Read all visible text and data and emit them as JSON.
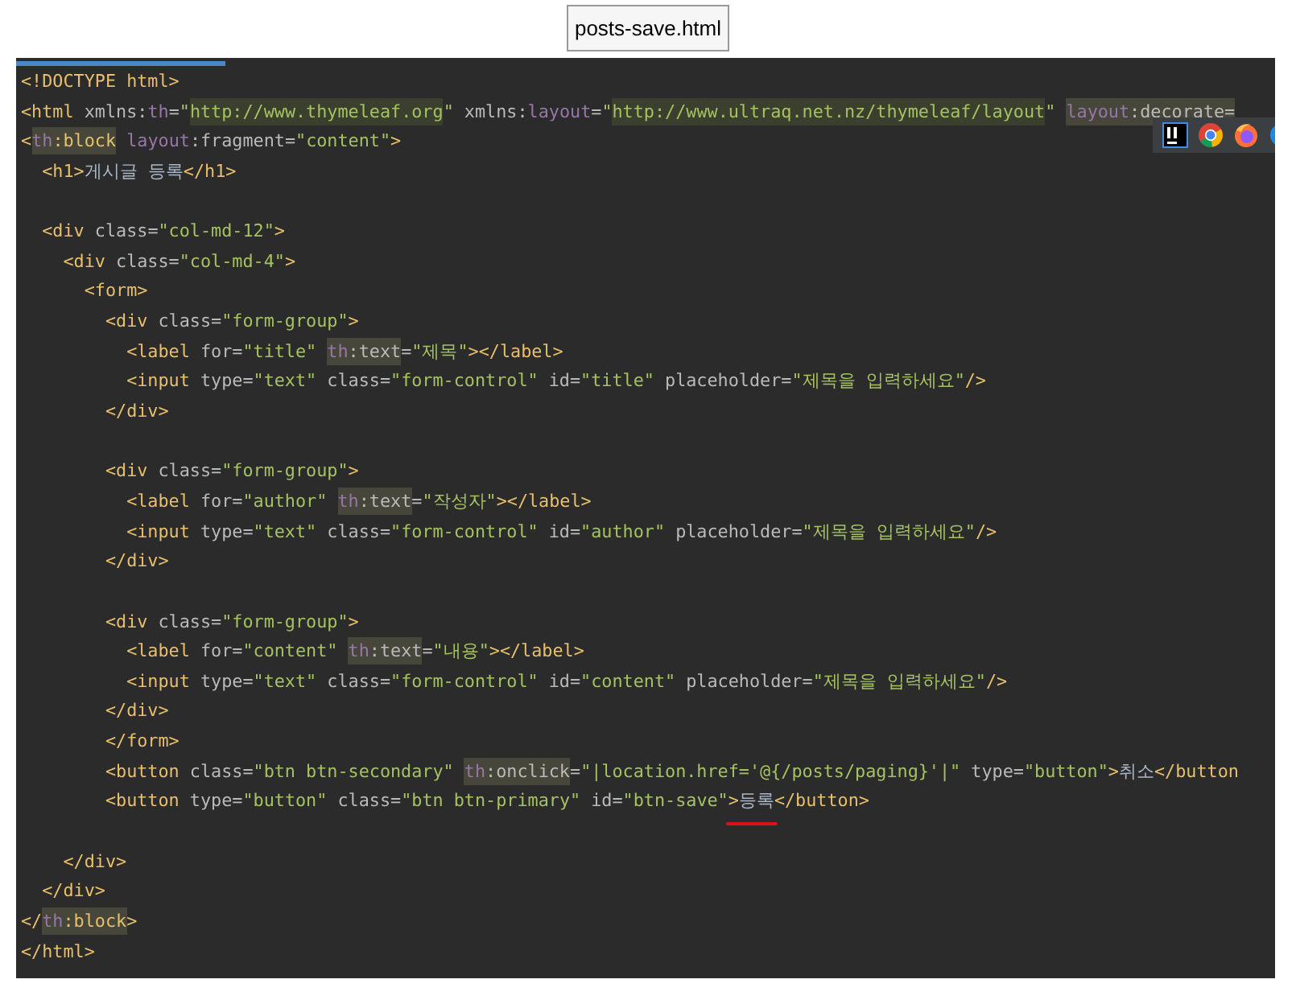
{
  "file_title": "posts-save.html",
  "lines": [
    {
      "kind": "code",
      "tokens": [
        {
          "kind": "tag",
          "text": "<!DOCTYPE html>"
        }
      ]
    },
    {
      "kind": "code",
      "tokens": [
        {
          "kind": "tag",
          "text": "<html "
        },
        {
          "kind": "attr",
          "text": "xmlns:"
        },
        {
          "kind": "ns",
          "text": "th"
        },
        {
          "kind": "attr",
          "text": "="
        },
        {
          "kind": "str",
          "text": "\""
        },
        {
          "kind": "strhl",
          "text": "http://www.thymeleaf.org"
        },
        {
          "kind": "str",
          "text": "\""
        },
        {
          "kind": "attr",
          "text": " xmlns:"
        },
        {
          "kind": "ns",
          "text": "layout"
        },
        {
          "kind": "attr",
          "text": "="
        },
        {
          "kind": "str",
          "text": "\""
        },
        {
          "kind": "strhl",
          "text": "http://www.ultraq.net.nz/thymeleaf/layout"
        },
        {
          "kind": "str",
          "text": "\" "
        },
        {
          "kind": "nshl",
          "text": "layout"
        },
        {
          "kind": "attrhl",
          "text": ":decorate="
        }
      ]
    },
    {
      "kind": "code",
      "tokens": [
        {
          "kind": "tag",
          "text": "<"
        },
        {
          "kind": "nshl",
          "text": "th"
        },
        {
          "kind": "taghl",
          "text": ":block"
        },
        {
          "kind": "ns",
          "text": " layout"
        },
        {
          "kind": "attr",
          "text": ":fragment="
        },
        {
          "kind": "str",
          "text": "\"content\""
        },
        {
          "kind": "tag",
          "text": ">"
        }
      ]
    },
    {
      "kind": "code",
      "tokens": [
        {
          "kind": "tag",
          "text": "  <h1>"
        },
        {
          "kind": "text",
          "text": "게시글 등록"
        },
        {
          "kind": "tag",
          "text": "</h1>"
        }
      ]
    },
    {
      "kind": "blank"
    },
    {
      "kind": "code",
      "tokens": [
        {
          "kind": "tag",
          "text": "  <div "
        },
        {
          "kind": "attr",
          "text": "class="
        },
        {
          "kind": "str",
          "text": "\"col-md-12\""
        },
        {
          "kind": "tag",
          "text": ">"
        }
      ]
    },
    {
      "kind": "code",
      "tokens": [
        {
          "kind": "tag",
          "text": "    <div "
        },
        {
          "kind": "attr",
          "text": "class="
        },
        {
          "kind": "str",
          "text": "\"col-md-4\""
        },
        {
          "kind": "tag",
          "text": ">"
        }
      ]
    },
    {
      "kind": "code",
      "tokens": [
        {
          "kind": "tag",
          "text": "      <form>"
        }
      ]
    },
    {
      "kind": "code",
      "tokens": [
        {
          "kind": "tag",
          "text": "        <div "
        },
        {
          "kind": "attr",
          "text": "class="
        },
        {
          "kind": "str",
          "text": "\"form-group\""
        },
        {
          "kind": "tag",
          "text": ">"
        }
      ]
    },
    {
      "kind": "code",
      "tokens": [
        {
          "kind": "tag",
          "text": "          <label "
        },
        {
          "kind": "attr",
          "text": "for="
        },
        {
          "kind": "str",
          "text": "\"title\" "
        },
        {
          "kind": "nshl",
          "text": "th"
        },
        {
          "kind": "attrhl",
          "text": ":text"
        },
        {
          "kind": "attr",
          "text": "="
        },
        {
          "kind": "str",
          "text": "\"제목\""
        },
        {
          "kind": "tag",
          "text": "></label>"
        }
      ]
    },
    {
      "kind": "code",
      "tokens": [
        {
          "kind": "tag",
          "text": "          <input "
        },
        {
          "kind": "attr",
          "text": "type="
        },
        {
          "kind": "str",
          "text": "\"text\""
        },
        {
          "kind": "attr",
          "text": " class="
        },
        {
          "kind": "str",
          "text": "\"form-control\""
        },
        {
          "kind": "attr",
          "text": " id="
        },
        {
          "kind": "str",
          "text": "\"title\""
        },
        {
          "kind": "attr",
          "text": " placeholder="
        },
        {
          "kind": "str",
          "text": "\"제목을 입력하세요\""
        },
        {
          "kind": "tag",
          "text": "/>"
        }
      ]
    },
    {
      "kind": "code",
      "tokens": [
        {
          "kind": "tag",
          "text": "        </div>"
        }
      ]
    },
    {
      "kind": "blank"
    },
    {
      "kind": "code",
      "tokens": [
        {
          "kind": "tag",
          "text": "        <div "
        },
        {
          "kind": "attr",
          "text": "class="
        },
        {
          "kind": "str",
          "text": "\"form-group\""
        },
        {
          "kind": "tag",
          "text": ">"
        }
      ]
    },
    {
      "kind": "code",
      "tokens": [
        {
          "kind": "tag",
          "text": "          <label "
        },
        {
          "kind": "attr",
          "text": "for="
        },
        {
          "kind": "str",
          "text": "\"author\" "
        },
        {
          "kind": "nshl",
          "text": "th"
        },
        {
          "kind": "attrhl",
          "text": ":text"
        },
        {
          "kind": "attr",
          "text": "="
        },
        {
          "kind": "str",
          "text": "\"작성자\""
        },
        {
          "kind": "tag",
          "text": "></label>"
        }
      ]
    },
    {
      "kind": "code",
      "tokens": [
        {
          "kind": "tag",
          "text": "          <input "
        },
        {
          "kind": "attr",
          "text": "type="
        },
        {
          "kind": "str",
          "text": "\"text\""
        },
        {
          "kind": "attr",
          "text": " class="
        },
        {
          "kind": "str",
          "text": "\"form-control\""
        },
        {
          "kind": "attr",
          "text": " id="
        },
        {
          "kind": "str",
          "text": "\"author\""
        },
        {
          "kind": "attr",
          "text": " placeholder="
        },
        {
          "kind": "str",
          "text": "\"제목을 입력하세요\""
        },
        {
          "kind": "tag",
          "text": "/>"
        }
      ]
    },
    {
      "kind": "code",
      "tokens": [
        {
          "kind": "tag",
          "text": "        </div>"
        }
      ]
    },
    {
      "kind": "blank"
    },
    {
      "kind": "code",
      "tokens": [
        {
          "kind": "tag",
          "text": "        <div "
        },
        {
          "kind": "attr",
          "text": "class="
        },
        {
          "kind": "str",
          "text": "\"form-group\""
        },
        {
          "kind": "tag",
          "text": ">"
        }
      ]
    },
    {
      "kind": "code",
      "tokens": [
        {
          "kind": "tag",
          "text": "          <label "
        },
        {
          "kind": "attr",
          "text": "for="
        },
        {
          "kind": "str",
          "text": "\"content\" "
        },
        {
          "kind": "nshl",
          "text": "th"
        },
        {
          "kind": "attrhl",
          "text": ":text"
        },
        {
          "kind": "attr",
          "text": "="
        },
        {
          "kind": "str",
          "text": "\"내용\""
        },
        {
          "kind": "tag",
          "text": "></label>"
        }
      ]
    },
    {
      "kind": "code",
      "tokens": [
        {
          "kind": "tag",
          "text": "          <input "
        },
        {
          "kind": "attr",
          "text": "type="
        },
        {
          "kind": "str",
          "text": "\"text\""
        },
        {
          "kind": "attr",
          "text": " class="
        },
        {
          "kind": "str",
          "text": "\"form-control\""
        },
        {
          "kind": "attr",
          "text": " id="
        },
        {
          "kind": "str",
          "text": "\"content\""
        },
        {
          "kind": "attr",
          "text": " placeholder="
        },
        {
          "kind": "str",
          "text": "\"제목을 입력하세요\""
        },
        {
          "kind": "tag",
          "text": "/>"
        }
      ]
    },
    {
      "kind": "code",
      "tokens": [
        {
          "kind": "tag",
          "text": "        </div>"
        }
      ]
    },
    {
      "kind": "code",
      "tokens": [
        {
          "kind": "tag",
          "text": "        </form>"
        }
      ]
    },
    {
      "kind": "code",
      "tokens": [
        {
          "kind": "tag",
          "text": "        <button "
        },
        {
          "kind": "attr",
          "text": "class="
        },
        {
          "kind": "str",
          "text": "\"btn btn-secondary\" "
        },
        {
          "kind": "nshl",
          "text": "th"
        },
        {
          "kind": "attrhl",
          "text": ":onclick"
        },
        {
          "kind": "attr",
          "text": "="
        },
        {
          "kind": "str",
          "text": "\"|location.href='@{/posts/paging}'|\""
        },
        {
          "kind": "attr",
          "text": " type="
        },
        {
          "kind": "str",
          "text": "\"button\""
        },
        {
          "kind": "tag",
          "text": ">"
        },
        {
          "kind": "text",
          "text": "취소"
        },
        {
          "kind": "tag",
          "text": "</button"
        }
      ]
    },
    {
      "kind": "code",
      "tokens": [
        {
          "kind": "tag",
          "text": "        <button "
        },
        {
          "kind": "attr",
          "text": "type="
        },
        {
          "kind": "str",
          "text": "\"button\""
        },
        {
          "kind": "attr",
          "text": " class="
        },
        {
          "kind": "str",
          "text": "\"btn btn-primary\""
        },
        {
          "kind": "attr",
          "text": " id="
        },
        {
          "kind": "str",
          "text": "\"btn-save\""
        },
        {
          "kind": "tag",
          "text": ">"
        },
        {
          "kind": "underlined",
          "text": "등록"
        },
        {
          "kind": "tag",
          "text": "</button>"
        }
      ]
    },
    {
      "kind": "blank"
    },
    {
      "kind": "code",
      "tokens": [
        {
          "kind": "tag",
          "text": "    </div>"
        }
      ]
    },
    {
      "kind": "code",
      "tokens": [
        {
          "kind": "tag",
          "text": "  </div>"
        }
      ]
    },
    {
      "kind": "code",
      "tokens": [
        {
          "kind": "tag",
          "text": "</"
        },
        {
          "kind": "nshl",
          "text": "th"
        },
        {
          "kind": "taghl",
          "text": ":block"
        },
        {
          "kind": "tag",
          "text": ">"
        }
      ]
    },
    {
      "kind": "code",
      "tokens": [
        {
          "kind": "tag",
          "text": "</html>"
        }
      ]
    }
  ]
}
